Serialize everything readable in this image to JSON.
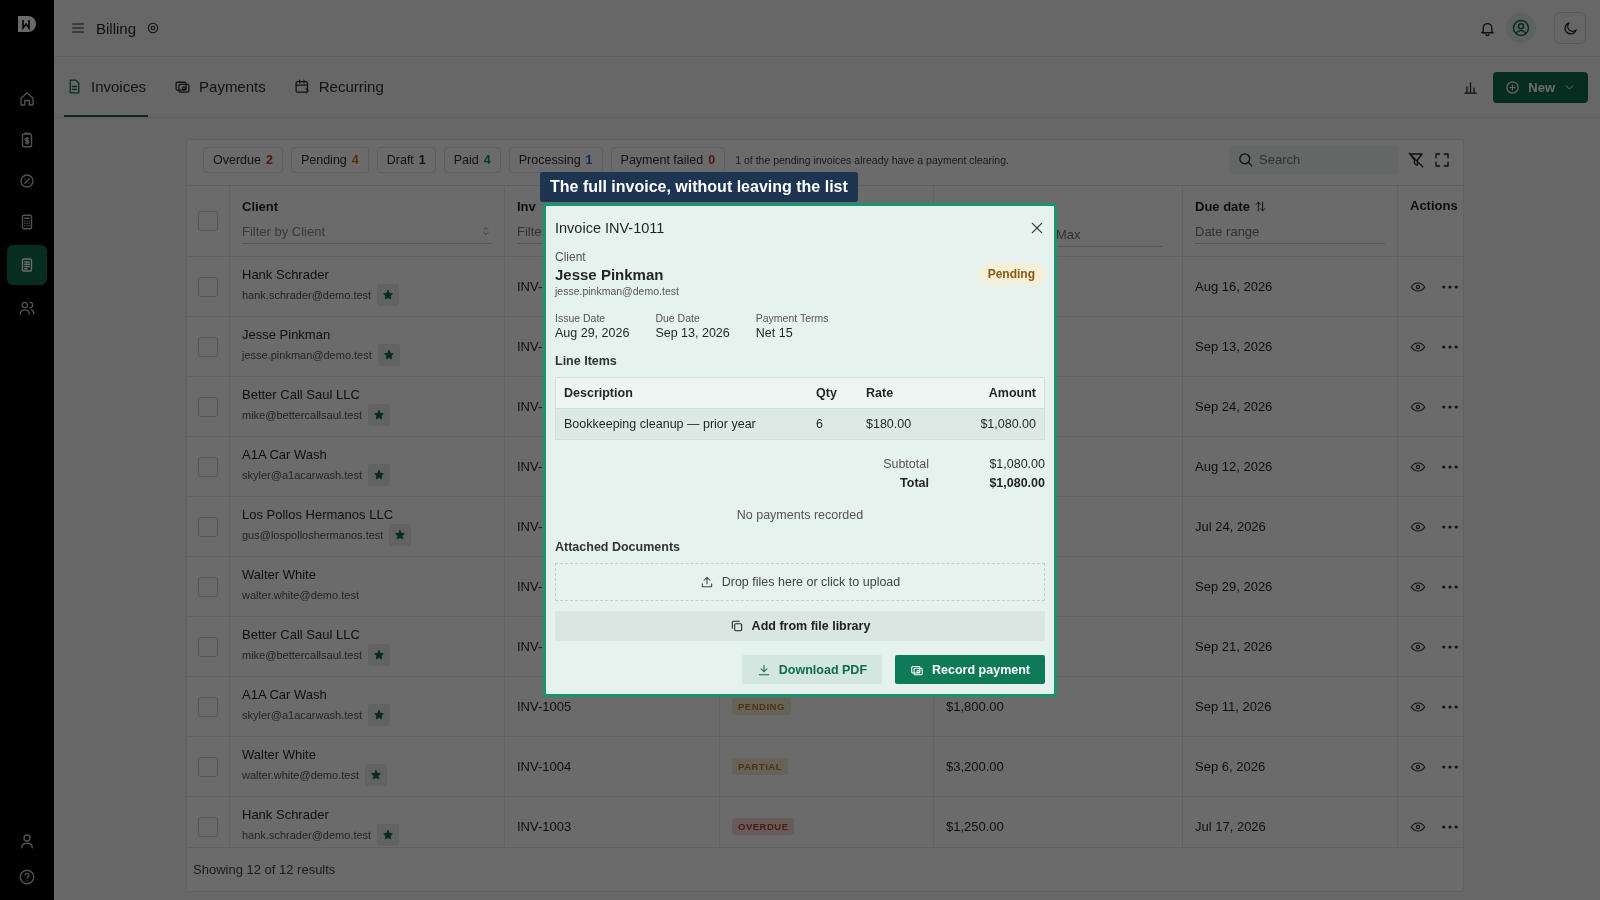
{
  "topbar": {
    "title": "Billing"
  },
  "sidebar": {
    "items": [
      {
        "selected": false
      },
      {
        "selected": false
      },
      {
        "selected": false
      },
      {
        "selected": false
      },
      {
        "selected": true
      },
      {
        "selected": false
      }
    ]
  },
  "tabs": [
    {
      "label": "Invoices",
      "selected": true
    },
    {
      "label": "Payments",
      "selected": false
    },
    {
      "label": "Recurring",
      "selected": false
    }
  ],
  "new_button": "New",
  "chips": [
    {
      "label": "Overdue",
      "count": "2",
      "kind": "danger"
    },
    {
      "label": "Pending",
      "count": "4",
      "kind": "warning"
    },
    {
      "label": "Draft",
      "count": "1",
      "kind": "neutral"
    },
    {
      "label": "Paid",
      "count": "4",
      "kind": "success"
    },
    {
      "label": "Processing",
      "count": "1",
      "kind": "info"
    },
    {
      "label": "Payment failed",
      "count": "0",
      "kind": "danger"
    }
  ],
  "chips_note": "1 of the pending invoices already have a payment clearing.",
  "search": {
    "placeholder": "Search"
  },
  "table": {
    "select_all": {
      "checked": false
    },
    "columns": {
      "client": "Client",
      "client_filter": "Filter by Client",
      "invoice": "Inv",
      "invoice_filter": {
        "placeholder": "Filte"
      },
      "amount_max": {
        "placeholder": "Max"
      },
      "due": "Due date",
      "due_filter": {
        "placeholder": "Date range"
      },
      "actions": "Actions"
    },
    "rows": [
      {
        "client": "Hank Schrader",
        "email": "hank.schrader@demo.test",
        "starred": true,
        "checked": false,
        "invoice": "INV-",
        "due": "Aug 16, 2026"
      },
      {
        "client": "Jesse Pinkman",
        "email": "jesse.pinkman@demo.test",
        "starred": true,
        "checked": false,
        "invoice": "INV-",
        "due": "Sep 13, 2026"
      },
      {
        "client": "Better Call Saul LLC",
        "email": "mike@bettercallsaul.test",
        "starred": true,
        "checked": false,
        "invoice": "INV-",
        "due": "Sep 24, 2026"
      },
      {
        "client": "A1A Car Wash",
        "email": "skyler@a1acarwash.test",
        "starred": true,
        "checked": false,
        "invoice": "INV-",
        "due": "Aug 12, 2026"
      },
      {
        "client": "Los Pollos Hermanos LLC",
        "email": "gus@lospolloshermanos.test",
        "starred": true,
        "checked": false,
        "invoice": "INV-",
        "due": "Jul 24, 2026"
      },
      {
        "client": "Walter White",
        "email": "walter.white@demo.test",
        "starred": false,
        "checked": false,
        "invoice": "INV-",
        "due": "Sep 29, 2026"
      },
      {
        "client": "Better Call Saul LLC",
        "email": "mike@bettercallsaul.test",
        "starred": true,
        "checked": false,
        "invoice": "INV-",
        "due": "Sep 21, 2026"
      },
      {
        "client": "A1A Car Wash",
        "email": "skyler@a1acarwash.test",
        "starred": true,
        "checked": false,
        "invoice": "INV-1005",
        "status": {
          "label": "PENDING",
          "kind": "warning"
        },
        "amount": "$1,800.00",
        "due": "Sep 11, 2026"
      },
      {
        "client": "Walter White",
        "email": "walter.white@demo.test",
        "starred": true,
        "checked": false,
        "invoice": "INV-1004",
        "status": {
          "label": "PARTIAL",
          "kind": "warning"
        },
        "amount": "$3,200.00",
        "due": "Sep 6, 2026"
      },
      {
        "client": "Hank Schrader",
        "email": "hank.schrader@demo.test",
        "starred": true,
        "checked": false,
        "invoice": "INV-1003",
        "status": {
          "label": "OVERDUE",
          "kind": "danger"
        },
        "amount": "$1,250.00",
        "due": "Jul 17, 2026"
      }
    ]
  },
  "footer": "Showing 12 of 12 results",
  "tooltip": "The full invoice, without leaving the list",
  "modal": {
    "title": "Invoice INV-1011",
    "client_label": "Client",
    "client_name": "Jesse Pinkman",
    "client_email": "jesse.pinkman@demo.test",
    "status": "Pending",
    "meta": [
      {
        "label": "Issue Date",
        "value": "Aug 29, 2026"
      },
      {
        "label": "Due Date",
        "value": "Sep 13, 2026"
      },
      {
        "label": "Payment Terms",
        "value": "Net 15"
      }
    ],
    "line_items_title": "Line Items",
    "line_columns": [
      "Description",
      "Qty",
      "Rate",
      "Amount"
    ],
    "line_items": [
      {
        "description": "Bookkeeping cleanup — prior year",
        "qty": "6",
        "rate": "$180.00",
        "amount": "$1,080.00"
      }
    ],
    "subtotal_label": "Subtotal",
    "subtotal": "$1,080.00",
    "total_label": "Total",
    "total": "$1,080.00",
    "payments_empty": "No payments recorded",
    "documents_title": "Attached Documents",
    "dropzone": "Drop files here or click to upload",
    "library_button": "Add from file library",
    "download_button": "Download PDF",
    "record_button": "Record payment"
  }
}
